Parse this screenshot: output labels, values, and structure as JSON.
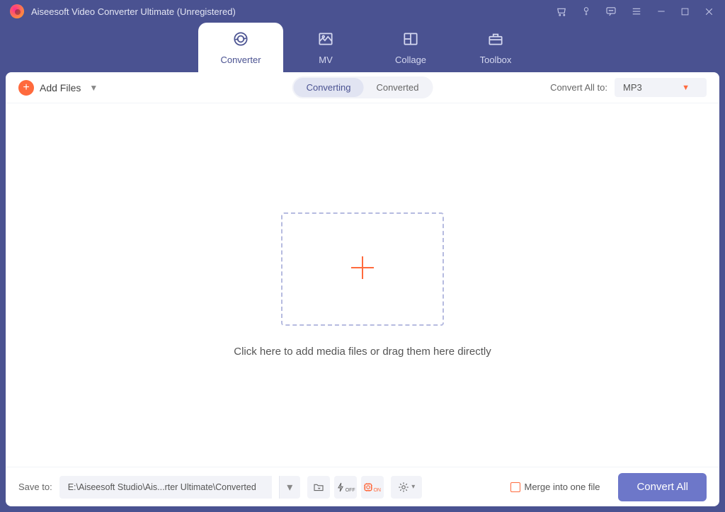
{
  "window": {
    "title": "Aiseesoft Video Converter Ultimate (Unregistered)"
  },
  "tabs": {
    "converter": "Converter",
    "mv": "MV",
    "collage": "Collage",
    "toolbox": "Toolbox"
  },
  "toolbar": {
    "add_files": "Add Files",
    "converting": "Converting",
    "converted": "Converted",
    "convert_all_to": "Convert All to:",
    "format": "MP3"
  },
  "dropzone": {
    "hint": "Click here to add media files or drag them here directly"
  },
  "bottom": {
    "save_to": "Save to:",
    "path": "E:\\Aiseesoft Studio\\Ais...rter Ultimate\\Converted",
    "merge": "Merge into one file",
    "convert_all": "Convert All"
  }
}
